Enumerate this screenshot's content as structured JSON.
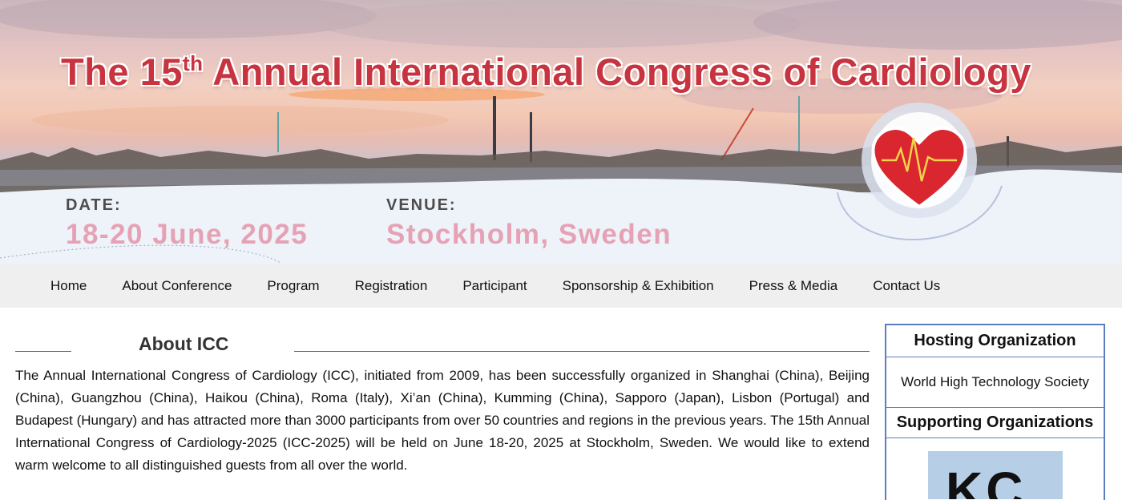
{
  "banner": {
    "title_pre": "The 15",
    "title_sup": "th",
    "title_post": " Annual International Congress of Cardiology",
    "date_label": "DATE:",
    "date_value": "18-20 June, 2025",
    "venue_label": "VENUE:",
    "venue_value": "Stockholm, Sweden",
    "heart_icon": "heart-ecg-icon",
    "colors": {
      "title": "#c7333f",
      "value": "#e6a2b5",
      "accent": "#3a62a8"
    }
  },
  "nav": {
    "items": [
      {
        "label": "Home"
      },
      {
        "label": "About Conference"
      },
      {
        "label": "Program"
      },
      {
        "label": "Registration"
      },
      {
        "label": "Participant"
      },
      {
        "label": "Sponsorship & Exhibition"
      },
      {
        "label": "Press & Media"
      },
      {
        "label": "Contact Us"
      }
    ]
  },
  "about": {
    "heading": "About ICC",
    "text": "The Annual International Congress of Cardiology (ICC), initiated from 2009, has been successfully organized in Shanghai (China), Beijing (China), Guangzhou (China), Haikou (China), Roma (Italy), Xi’an (China), Kumming (China), Sapporo (Japan), Lisbon (Portugal) and Budapest (Hungary) and has attracted more than 3000 participants from over 50 countries and regions in the previous years. The 15th Annual International Congress of Cardiology-2025 (ICC-2025) will be held on June 18-20, 2025 at Stockholm, Sweden. We would like to extend warm welcome to all distinguished guests from all over the world."
  },
  "sidebar": {
    "hosting_heading": "Hosting Organization",
    "hosting_org": "World High Technology Society",
    "supporting_heading": "Supporting Organizations",
    "supporting_logo_text": "KC"
  }
}
